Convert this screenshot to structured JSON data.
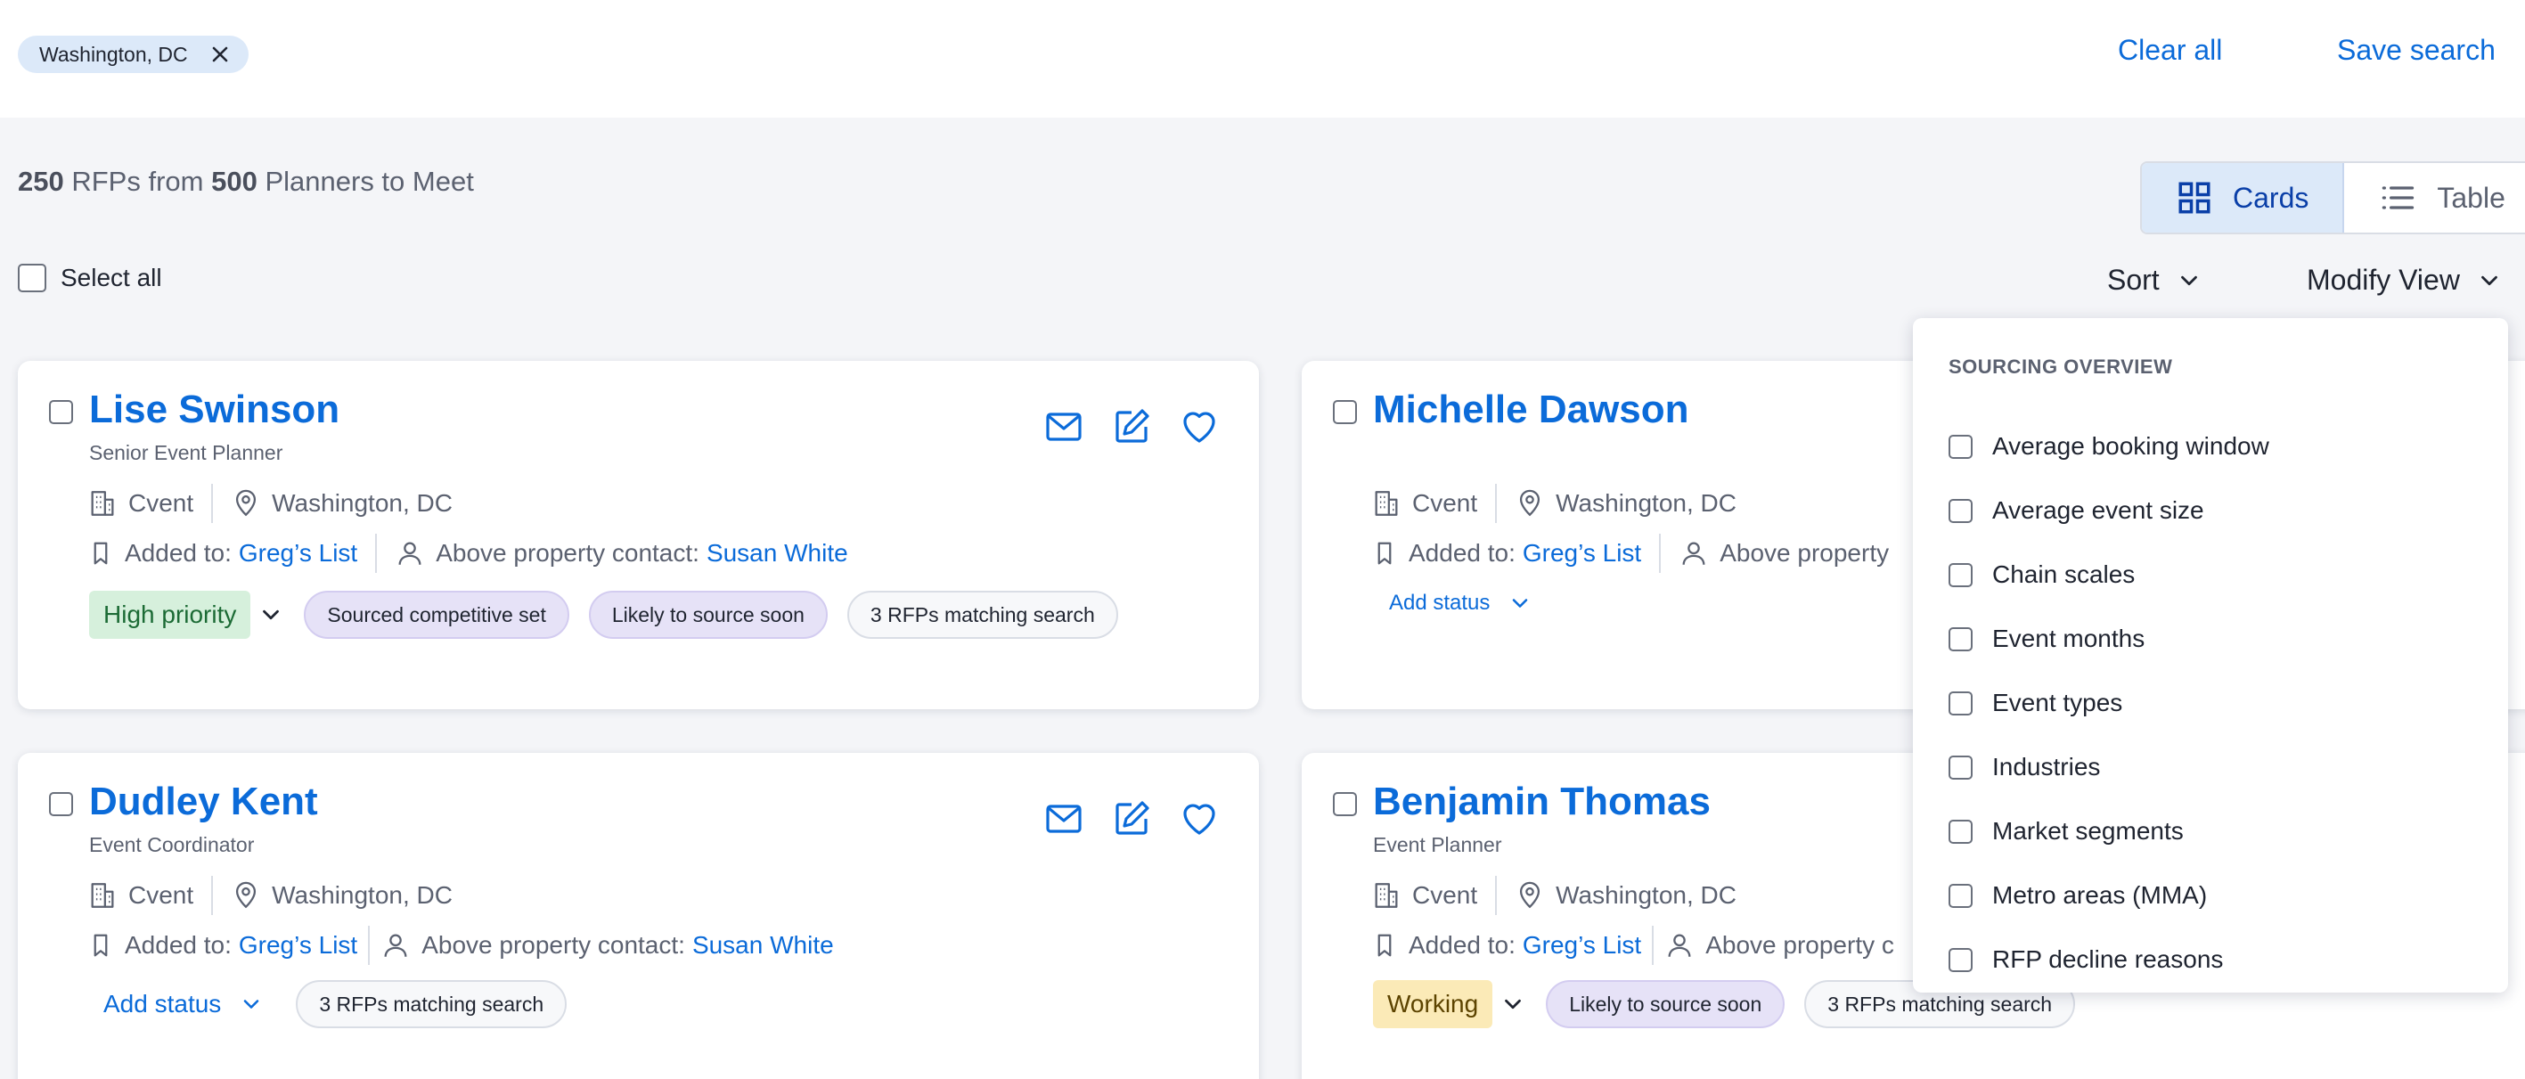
{
  "filters": {
    "chip_label": "Washington, DC",
    "clear_all": "Clear all",
    "save_search": "Save search"
  },
  "summary": {
    "rfp_count": "250",
    "rfps_from": "RFPs from",
    "planner_count": "500",
    "planners_label": "Planners to Meet"
  },
  "view_toggle": {
    "cards": "Cards",
    "table": "Table"
  },
  "controls": {
    "select_all": "Select all",
    "sort": "Sort",
    "modify_view": "Modify View"
  },
  "labels": {
    "added_to": "Added to:",
    "above_property_contact": "Above property contact:",
    "above_property_truncated": "Above property",
    "above_property_c": "Above property c",
    "add_status": "Add status"
  },
  "cards": [
    {
      "name": "Lise Swinson",
      "role": "Senior Event Planner",
      "company": "Cvent",
      "location": "Washington, DC",
      "list": "Greg’s List",
      "contact": "Susan White",
      "status": "High priority",
      "tags": [
        "Sourced competitive set",
        "Likely to source soon",
        "3 RFPs matching search"
      ]
    },
    {
      "name": "Michelle Dawson",
      "role": "",
      "company": "Cvent",
      "location": "Washington, DC",
      "list": "Greg’s List"
    },
    {
      "name": "Dudley Kent",
      "role": "Event Coordinator",
      "company": "Cvent",
      "location": "Washington, DC",
      "list": "Greg’s List",
      "contact": "Susan White",
      "tags": [
        "3 RFPs matching search"
      ]
    },
    {
      "name": "Benjamin Thomas",
      "role": "Event Planner",
      "company": "Cvent",
      "location": "Washington, DC",
      "list": "Greg’s List",
      "status": "Working",
      "tags": [
        "Likely to source soon",
        "3 RFPs matching search"
      ]
    }
  ],
  "modify_view_menu": {
    "heading": "SOURCING OVERVIEW",
    "items": [
      "Average booking window",
      "Average event size",
      "Chain scales",
      "Event months",
      "Event types",
      "Industries",
      "Market segments",
      "Metro areas (MMA)",
      "RFP decline reasons"
    ]
  },
  "colors": {
    "accent": "#0b6bd9",
    "chip_bg": "#dce9f9",
    "priority_green": "#d6f0dc",
    "working_yellow": "#fbeab7",
    "tag_purple": "#e6e2f7"
  }
}
